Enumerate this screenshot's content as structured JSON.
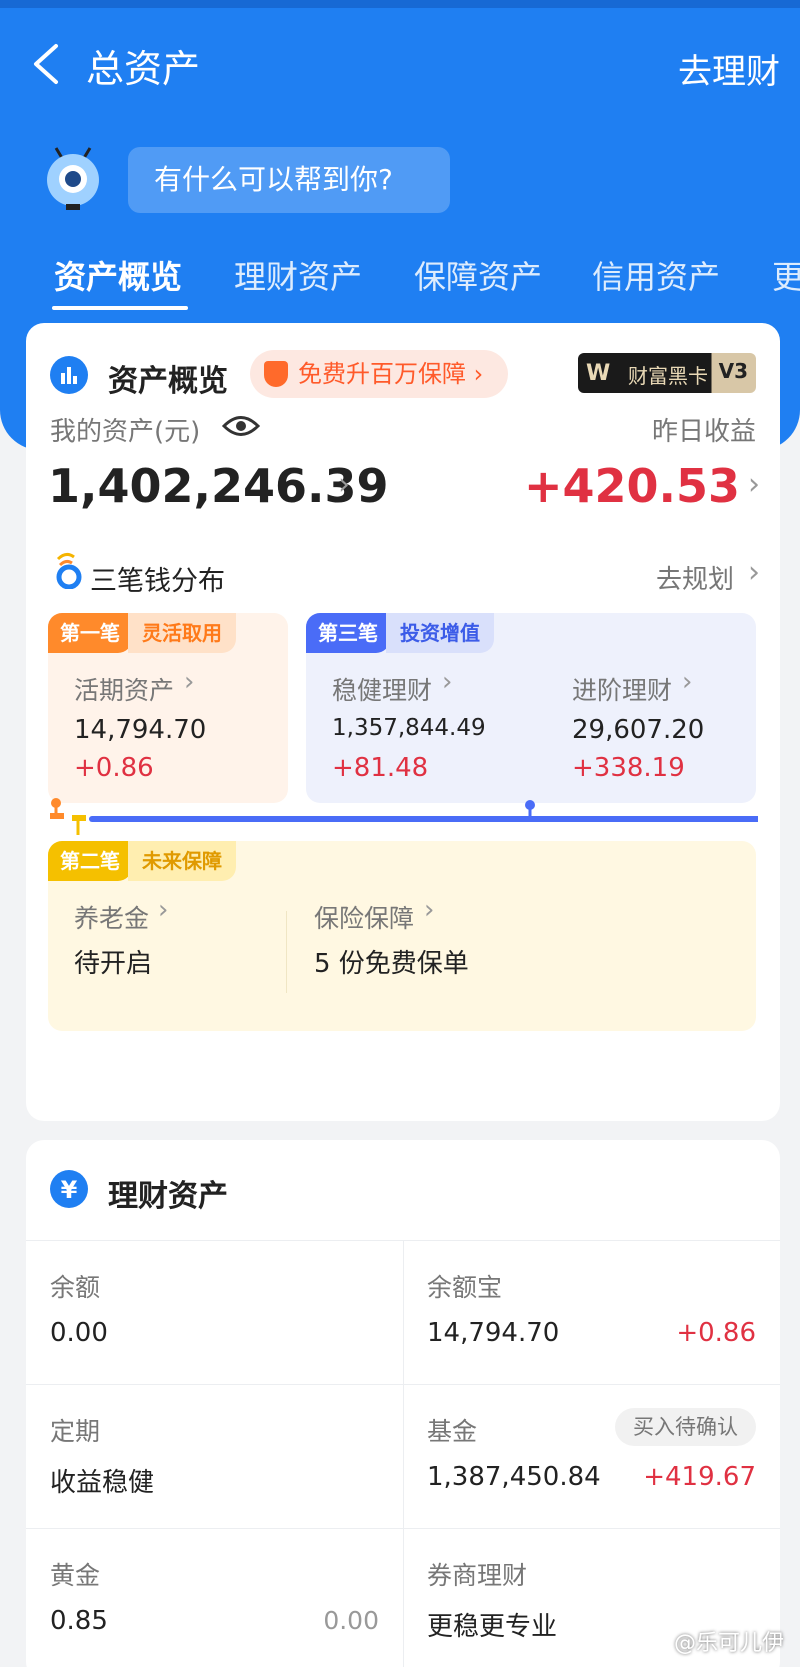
{
  "header": {
    "title": "总资产",
    "right_action": "去理财",
    "assistant_prompt": "有什么可以帮到你?"
  },
  "tabs": [
    {
      "label": "资产概览",
      "active": true
    },
    {
      "label": "理财资产",
      "active": false
    },
    {
      "label": "保障资产",
      "active": false
    },
    {
      "label": "信用资产",
      "active": false
    },
    {
      "label": "更",
      "active": false
    }
  ],
  "overview": {
    "section_title": "资产概览",
    "promo": "免费升百万保障",
    "vip_card": {
      "logo": "W",
      "name": "财富黑卡",
      "level": "V3"
    },
    "my_assets_label": "我的资产(元)",
    "my_assets_value": "1,402,246.39",
    "yesterday_label": "昨日收益",
    "yesterday_value": "+420.53",
    "distribution_title": "三笔钱分布",
    "plan_link": "去规划",
    "first": {
      "tag": "第一笔",
      "tag_desc": "灵活取用",
      "item_label": "活期资产",
      "item_value": "14,794.70",
      "item_change": "+0.86"
    },
    "third": {
      "tag": "第三笔",
      "tag_desc": "投资增值",
      "items": [
        {
          "label": "稳健理财",
          "value": "1,357,844.49",
          "change": "+81.48"
        },
        {
          "label": "进阶理财",
          "value": "29,607.20",
          "change": "+338.19"
        }
      ]
    },
    "second": {
      "tag": "第二笔",
      "tag_desc": "未来保障",
      "items": [
        {
          "label": "养老金",
          "value": "待开启"
        },
        {
          "label": "保险保障",
          "value": "5 份免费保单"
        }
      ]
    }
  },
  "finance": {
    "section_title": "理财资产",
    "icon": "yen-icon",
    "cells": [
      {
        "label": "余额",
        "value": "0.00",
        "extra": ""
      },
      {
        "label": "余额宝",
        "value": "14,794.70",
        "extra": "+0.86"
      },
      {
        "label": "定期",
        "value": "收益稳健",
        "extra": ""
      },
      {
        "label": "基金",
        "value": "1,387,450.84",
        "extra": "+419.67",
        "badge": "买入待确认"
      },
      {
        "label": "黄金",
        "value": "0.85",
        "extra": "0.00"
      },
      {
        "label": "券商理财",
        "value": "更稳更专业",
        "extra": ""
      }
    ]
  },
  "watermark": "@乐可儿伊",
  "colors": {
    "brand_blue": "#1f7ff2",
    "gain_red": "#e03142",
    "promo_orange": "#ff5a2a"
  }
}
